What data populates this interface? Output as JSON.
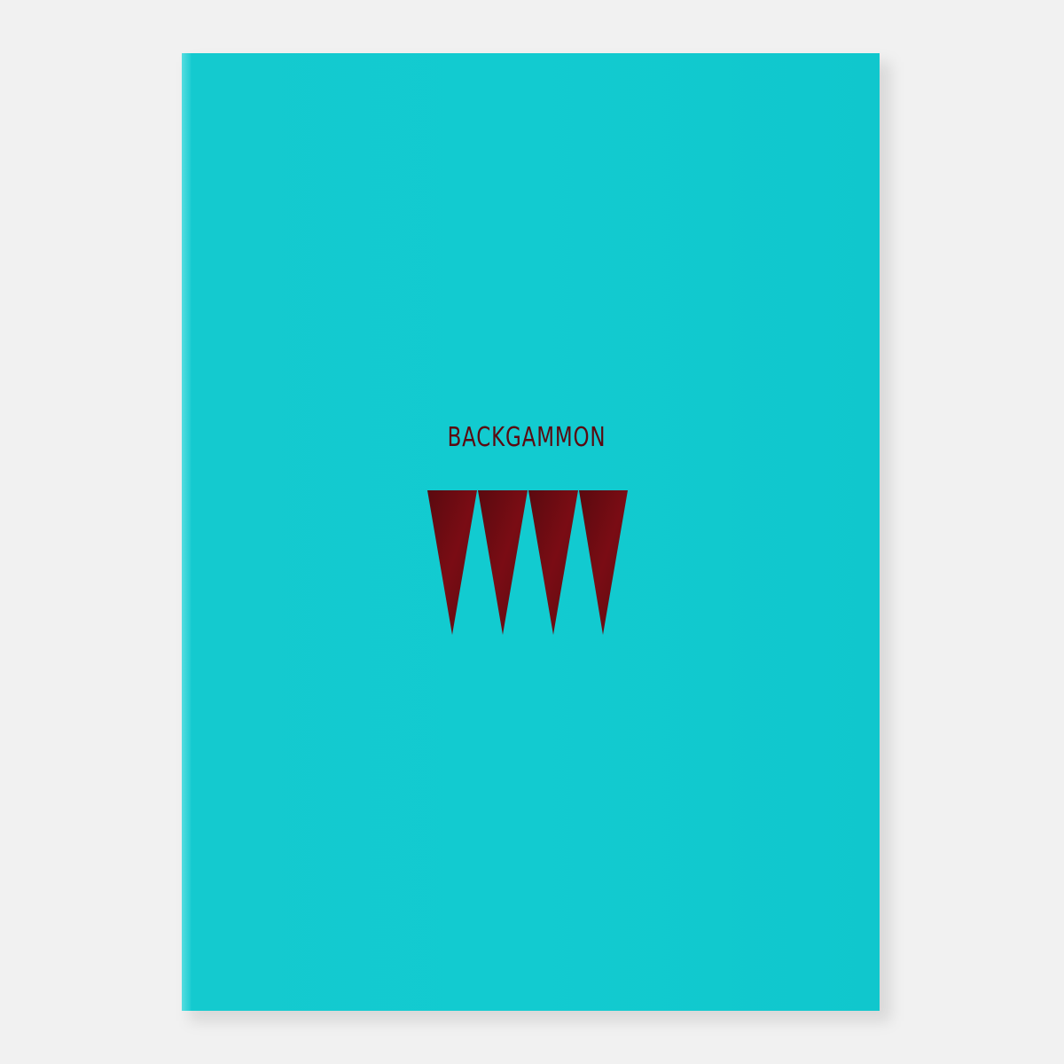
{
  "product": {
    "title": "BACKGAMMON",
    "box_color": "#12cbd0",
    "print_color": "#6b0a10",
    "triangle_count": 4
  }
}
